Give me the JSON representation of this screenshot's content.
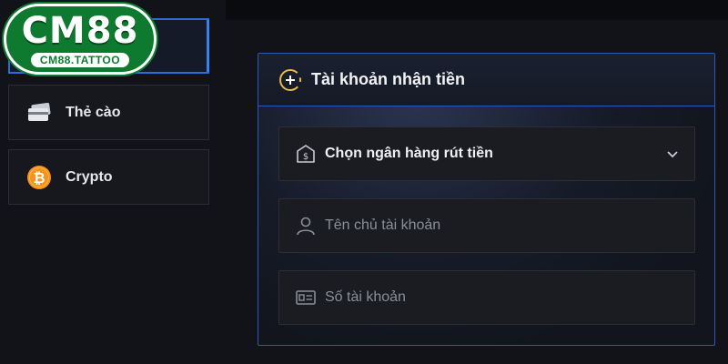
{
  "logo": {
    "main": "CM88",
    "sub": "CM88.TATTOO"
  },
  "sidebar": {
    "items": [
      {
        "label": "",
        "icon": "active-tab",
        "active": true
      },
      {
        "label": "Thẻ cào",
        "icon": "card-icon"
      },
      {
        "label": "Crypto",
        "icon": "bitcoin-icon"
      }
    ]
  },
  "panel": {
    "title": "Tài khoản nhận tiền",
    "bank_select": "Chọn ngân hàng rút tiền",
    "name_placeholder": "Tên chủ tài khoản",
    "account_placeholder": "Số tài khoản"
  },
  "colors": {
    "accent": "#2f6bd6",
    "logo_green": "#0e7a2f",
    "bitcoin": "#f7931a",
    "plus_gold": "#e9b949"
  }
}
